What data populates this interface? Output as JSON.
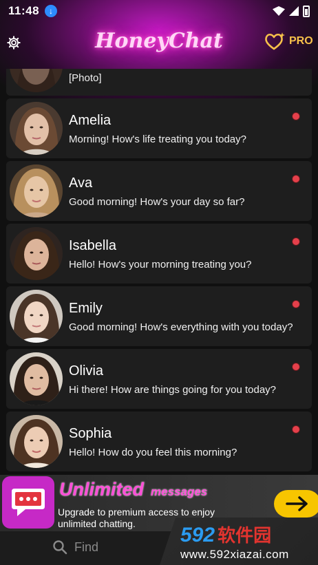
{
  "status_bar": {
    "time": "11:48"
  },
  "header": {
    "title": "HoneyChat",
    "pro_label": "PRO"
  },
  "chats": [
    {
      "name": "",
      "message": "[Photo]",
      "avatar": "avatar-0",
      "partial": true
    },
    {
      "name": "Amelia",
      "message": "Morning! How's life treating you today?",
      "avatar": "avatar-amelia"
    },
    {
      "name": "Ava",
      "message": "Good morning! How's your day so far?",
      "avatar": "avatar-ava"
    },
    {
      "name": "Isabella",
      "message": "Hello! How's your morning treating you?",
      "avatar": "avatar-isabella"
    },
    {
      "name": "Emily",
      "message": "Good morning! How's everything with you today?",
      "avatar": "avatar-emily"
    },
    {
      "name": "Olivia",
      "message": "Hi there! How are things going for you today?",
      "avatar": "avatar-olivia"
    },
    {
      "name": "Sophia",
      "message": "Hello! How do you feel this morning?",
      "avatar": "avatar-sophia"
    }
  ],
  "ad": {
    "title_main": "Unlimited",
    "title_sub": "messages",
    "description": "Upgrade to premium access to enjoy unlimited chatting."
  },
  "bottom": {
    "find_label": "Find"
  },
  "watermark": {
    "logo_num": "592",
    "logo_cn": "软件园",
    "url": "www.592xiazai.com"
  },
  "colors": {
    "accent_pink": "#ff4fd8",
    "pro_gold": "#f6c04a",
    "unread_red": "#e5404b",
    "card_bg": "#1e1e1e"
  }
}
